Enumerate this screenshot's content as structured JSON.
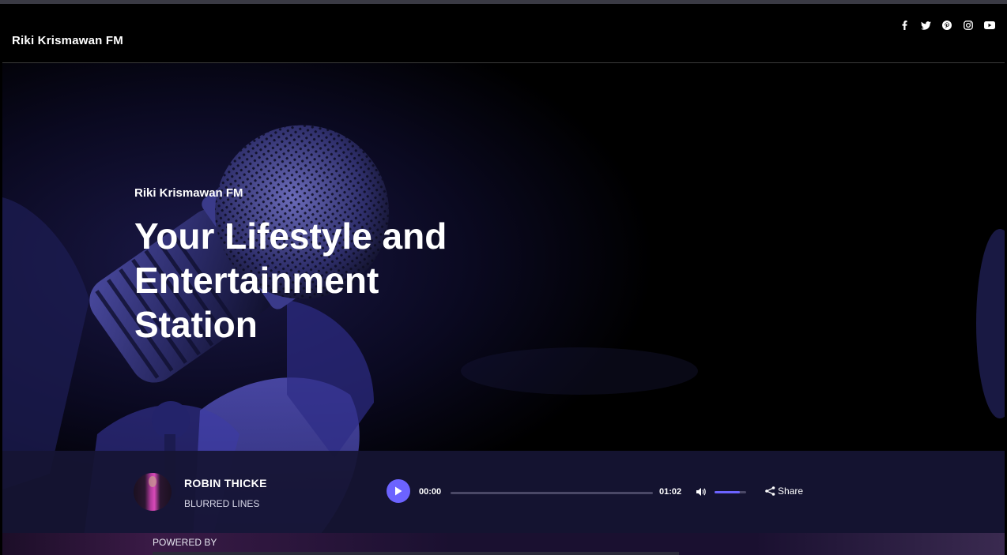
{
  "header": {
    "brand": "Riki Krismawan FM",
    "social": [
      "facebook-icon",
      "twitter-icon",
      "pinterest-icon",
      "instagram-icon",
      "youtube-icon"
    ]
  },
  "hero": {
    "subtitle": "Riki Krismawan FM",
    "title": "Your Lifestyle and Entertainment Station"
  },
  "player": {
    "artist": "ROBIN THICKE",
    "song": "BLURRED LINES",
    "current_time": "00:00",
    "total_time": "01:02",
    "progress": 0,
    "volume": 0.8,
    "share_label": "Share"
  },
  "footer": {
    "powered_label": "POWERED BY"
  },
  "colors": {
    "accent": "#6c63ff",
    "player_bg": "#161434",
    "header_bg": "#000000"
  }
}
